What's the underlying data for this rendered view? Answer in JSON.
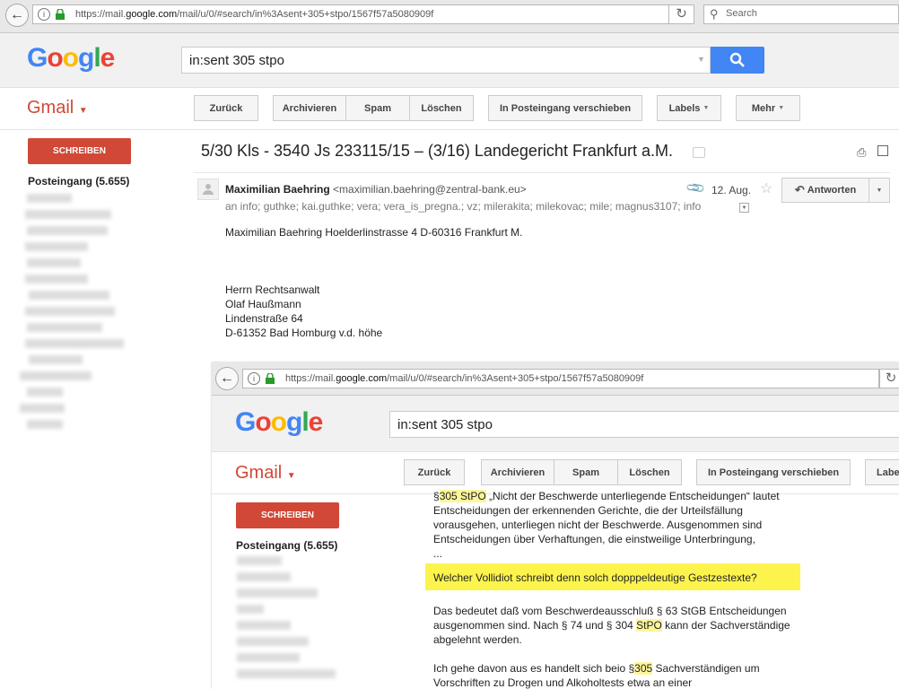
{
  "browser": {
    "url_prefix": "https://mail.",
    "url_domain": "google.com",
    "url_suffix": "/mail/u/0/#search/in%3Asent+305+stpo/1567f57a5080909f",
    "search_placeholder": "Search"
  },
  "google": {
    "logo_letters": [
      "G",
      "o",
      "o",
      "g",
      "l",
      "e"
    ],
    "logo_colors": [
      "#4285f4",
      "#ea4335",
      "#fbbc05",
      "#4285f4",
      "#34a853",
      "#ea4335"
    ],
    "search_value": "in:sent 305 stpo"
  },
  "gmail": {
    "label": "Gmail",
    "compose": "SCHREIBEN",
    "inbox": "Posteingang (5.655)"
  },
  "toolbar": {
    "back": "Zurück",
    "archive": "Archivieren",
    "spam": "Spam",
    "delete": "Löschen",
    "move_inbox": "In Posteingang verschieben",
    "labels": "Labels",
    "more": "Mehr"
  },
  "email": {
    "subject": "5/30 Kls - 3540 Js 233115/15 – (3/16) Landegericht Frankfurt a.M.",
    "sender_name": "Maximilian Baehring",
    "sender_email": "<maximilian.baehring@zentral-bank.eu>",
    "date": "12. Aug.",
    "reply": "Antworten",
    "recipients": "an info; guthke; kai.guthke; vera; vera_is_pregna.; vz; milerakita; milekovac; mile; magnus3107; info",
    "body_address": "Maximilian Baehring  Hoelderlinstrasse 4  D-60316 Frankfurt M.",
    "body_lines": [
      "Herrn Rechtsanwalt",
      "Olaf Haußmann",
      "Lindenstraße  64",
      "D-61352 Bad Homburg v.d. höhe"
    ]
  },
  "inner": {
    "labels_partial": "Labe",
    "p1_a": "§",
    "p1_hl": "305 StPO",
    "p1_b": " „Nicht der Beschwerde unterliegende Entscheidungen“ lautet",
    "p1_lines": [
      "Entscheidungen der erkennenden Gerichte, die der Urteilsfällung",
      "vorausgehen, unterliegen nicht der Beschwerde. Ausgenommen sind",
      "Entscheidungen über Verhaftungen, die einstweilige Unterbringung,",
      "..."
    ],
    "question": "Welcher Vollidiot schreibt denn solch dopppeldeutige Gestzestexte?",
    "p2_line1": "Das bedeutet daß vom Beschwerdeausschluß § 63 StGB Entscheidungen",
    "p2_line2_a": "ausgenommen sind. Nach § 74  und § 304 ",
    "p2_line2_hl": "StPO",
    "p2_line2_b": " kann der Sachverständige",
    "p2_line3": "abgelehnt werden.",
    "p3_line1_a": "Ich gehe davon aus es handelt sich beio §",
    "p3_line1_hl": "305",
    "p3_line1_b": " Sachverständigen um",
    "p3_line2": "Vorschriften zu Drogen und Alkoholtests etwa an einer"
  }
}
